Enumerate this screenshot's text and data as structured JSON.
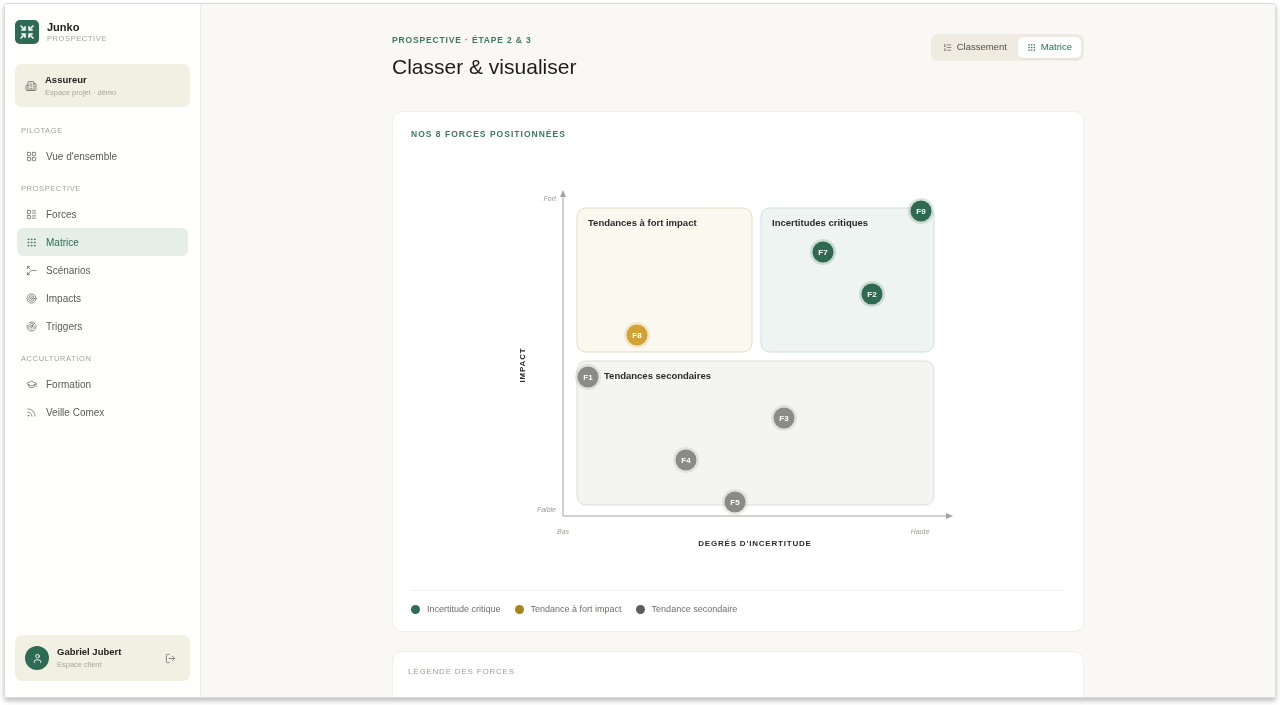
{
  "sidebar": {
    "brand": {
      "name": "Junko",
      "subtitle": "PROSPECTIVE"
    },
    "project": {
      "name": "Assureur",
      "subtitle": "Espace projet · démo"
    },
    "sections": [
      {
        "title": "PILOTAGE",
        "items": [
          {
            "label": "Vue d'ensemble",
            "selected": false
          }
        ]
      },
      {
        "title": "PROSPECTIVE",
        "items": [
          {
            "label": "Forces",
            "selected": false
          },
          {
            "label": "Matrice",
            "selected": true
          },
          {
            "label": "Scénarios",
            "selected": false
          },
          {
            "label": "Impacts",
            "selected": false
          },
          {
            "label": "Triggers",
            "selected": false
          }
        ]
      },
      {
        "title": "ACCULTURATION",
        "items": [
          {
            "label": "Formation",
            "selected": false
          },
          {
            "label": "Veille Comex",
            "selected": false
          }
        ]
      }
    ],
    "user": {
      "name": "Gabriel Jubert",
      "subtitle": "Espace client"
    }
  },
  "header": {
    "breadcrumb": "PROSPECTIVE · ÉTAPE 2 & 3",
    "title": "Classer & visualiser",
    "view_toggle": [
      {
        "label": "Classement",
        "selected": false
      },
      {
        "label": "Matrice",
        "selected": true
      }
    ]
  },
  "matrix_card": {
    "title": "NOS 8 FORCES POSITIONNÉES",
    "matrix": {
      "y_axis": {
        "title": "IMPACT",
        "ends": [
          "Fort",
          "Faible"
        ]
      },
      "x_axis": {
        "title": "DEGRÉS D'INCERTITUDE",
        "ends": [
          "Bas",
          "Haute"
        ]
      },
      "quadrants": [
        {
          "label": "Tendances à fort impact"
        },
        {
          "label": "Incertitudes critiques"
        },
        {
          "label": "Tendances secondaires"
        }
      ],
      "forces": [
        {
          "label": "F9",
          "color": "#2e6a51"
        },
        {
          "label": "F7",
          "color": "#2e6a51"
        },
        {
          "label": "F2",
          "color": "#2e6a51"
        },
        {
          "label": "F8",
          "color": "#d2a234"
        },
        {
          "label": "F1",
          "color": "#8a8a86"
        },
        {
          "label": "F3",
          "color": "#8a8a86"
        },
        {
          "label": "F4",
          "color": "#8a8a86"
        },
        {
          "label": "F5",
          "color": "#8a8a86"
        }
      ]
    },
    "legend": [
      {
        "label": "Incertitude critique",
        "color": "#2e6b58"
      },
      {
        "label": "Tendance à fort impact",
        "color": "#a8841f"
      },
      {
        "label": "Tendance secondaire",
        "color": "#5d5d5d"
      }
    ]
  },
  "legend_card": {
    "title": "LÉGENDE DES FORCES"
  }
}
